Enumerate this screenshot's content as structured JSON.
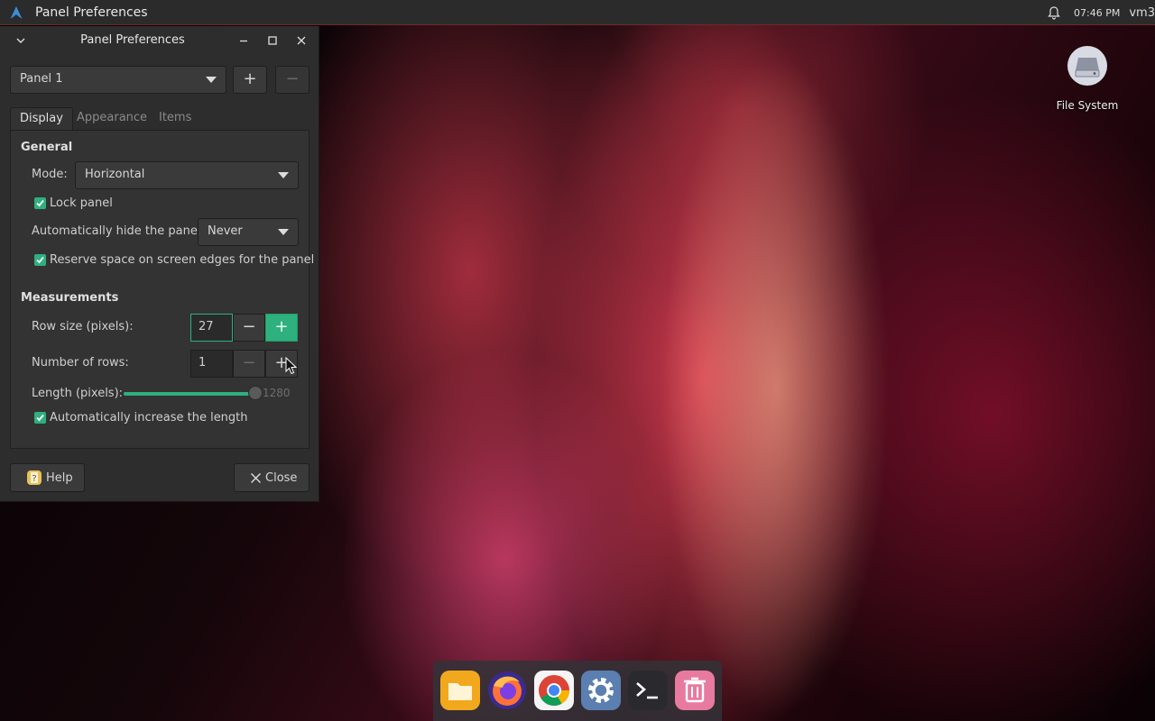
{
  "topbar": {
    "title": "Panel Preferences",
    "clock": "07:46 PM",
    "host": "vm3"
  },
  "window": {
    "title": "Panel Preferences",
    "panel_select": "Panel 1",
    "add_symbol": "+",
    "remove_symbol": "−",
    "tabs": [
      {
        "label": "Display"
      },
      {
        "label": "Appearance"
      },
      {
        "label": "Items"
      }
    ],
    "general": {
      "heading": "General",
      "mode_label": "Mode:",
      "mode_value": "Horizontal",
      "lock_label": "Lock panel",
      "lock_checked": true,
      "autohide_label": "Automatically hide the panel:",
      "autohide_value": "Never",
      "reserve_label": "Reserve space on screen edges for the panel",
      "reserve_checked": true
    },
    "measurements": {
      "heading": "Measurements",
      "row_size_label": "Row size (pixels):",
      "row_size_value": "27",
      "rows_label": "Number of rows:",
      "rows_value": "1",
      "length_label": "Length (pixels):",
      "length_value": "1280",
      "auto_length_label": "Automatically increase the length",
      "auto_length_checked": true,
      "minus": "−",
      "plus": "+"
    },
    "help_label": "Help",
    "close_label": "Close"
  },
  "desktop": {
    "icon_label": "File System"
  },
  "dock": {
    "items": [
      "file-manager-icon",
      "firefox-icon",
      "chrome-icon",
      "settings-icon",
      "terminal-icon",
      "trash-icon"
    ]
  },
  "colors": {
    "accent": "#2eb07f",
    "window_bg": "#2d2d2d",
    "topbar_bg": "#2b2b2b"
  }
}
